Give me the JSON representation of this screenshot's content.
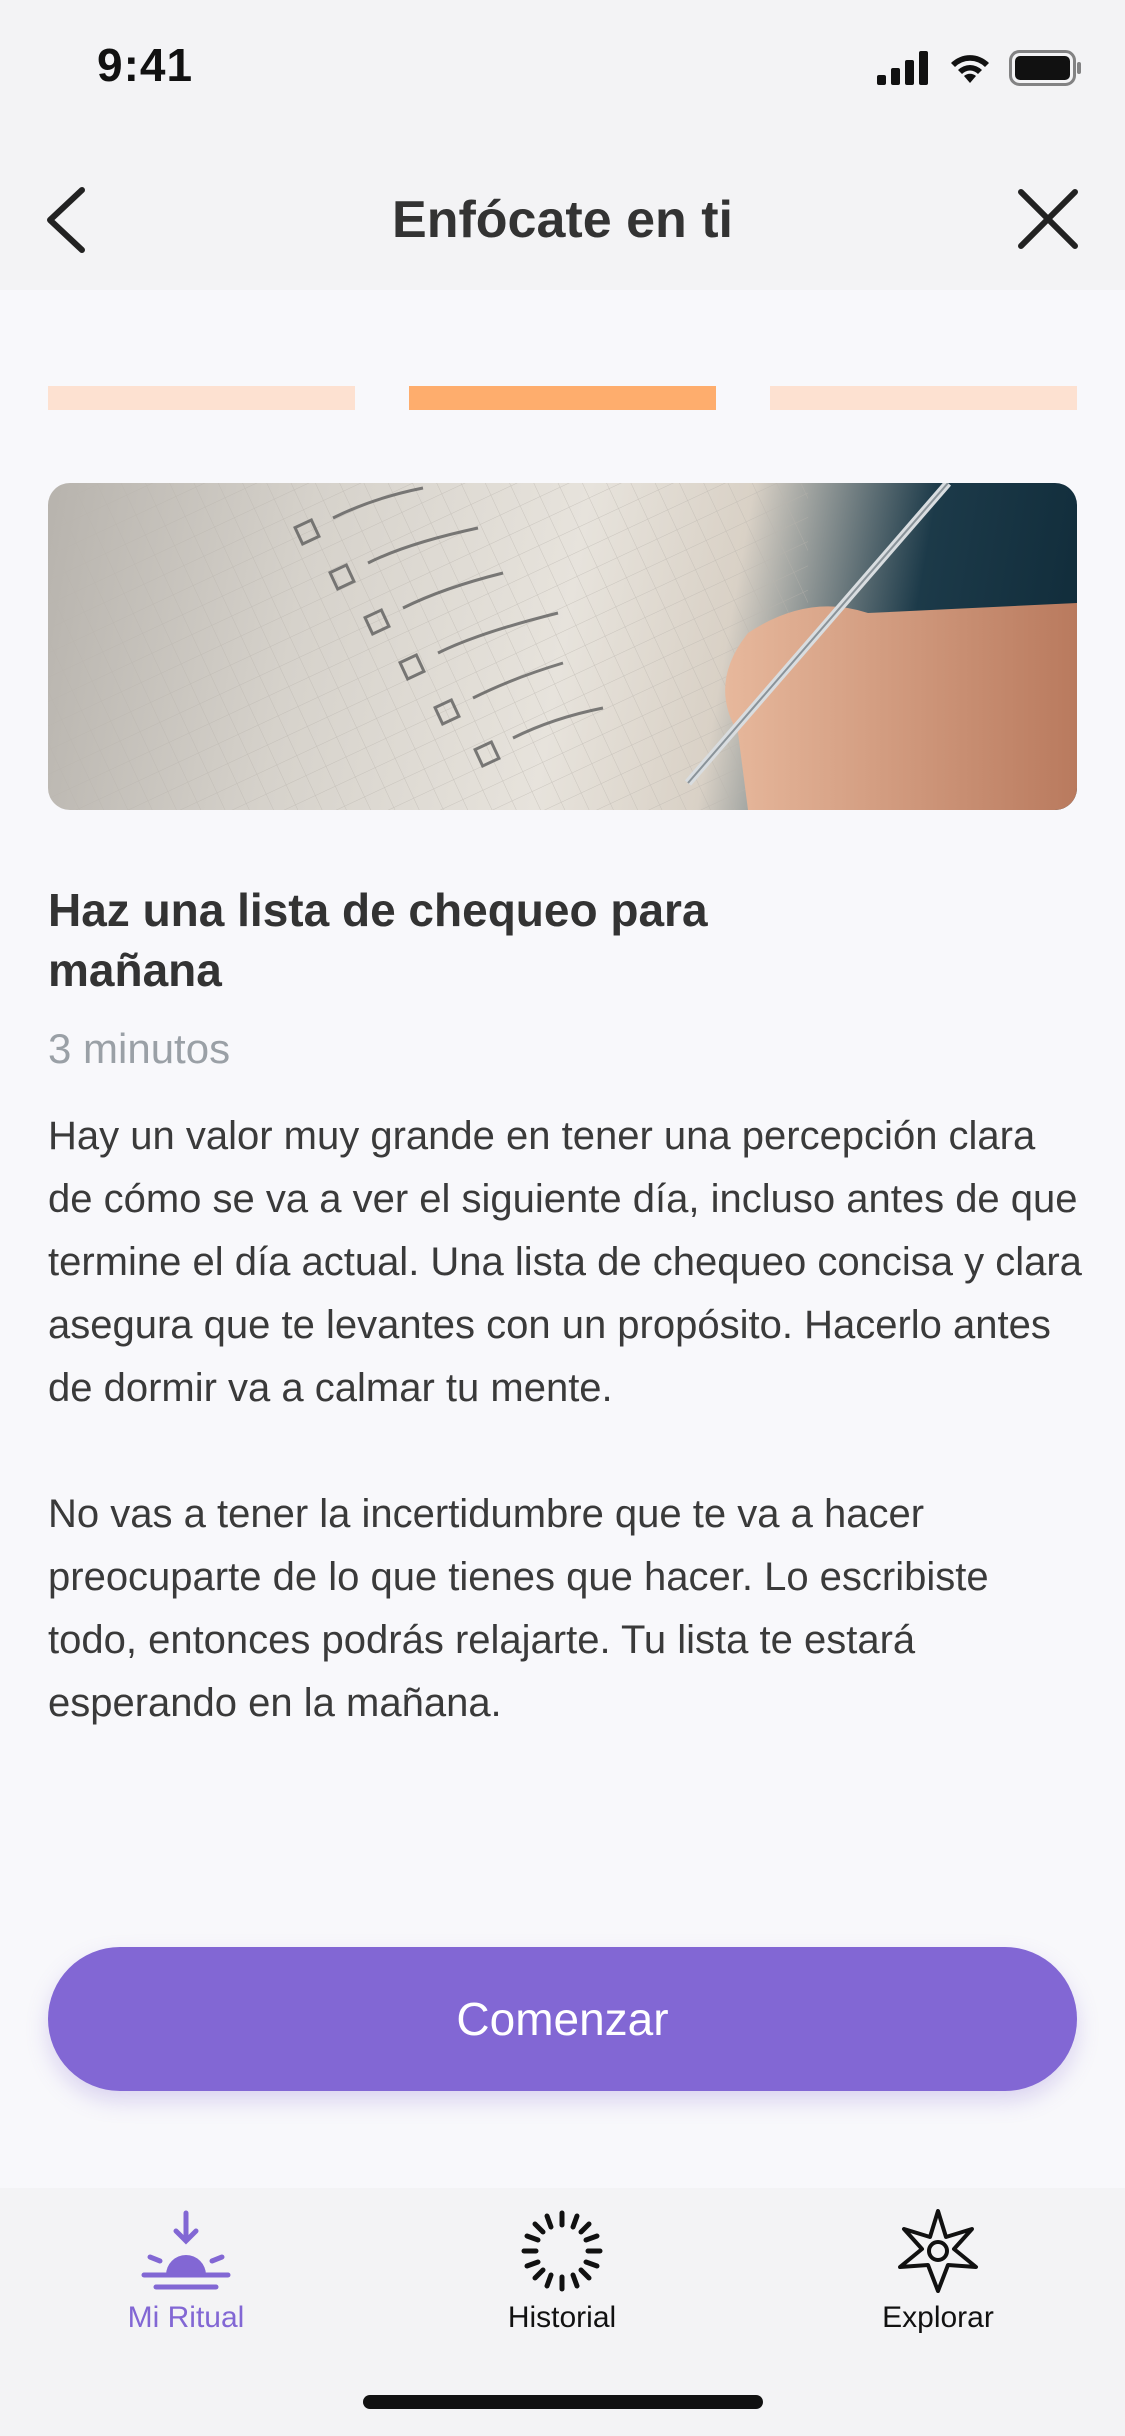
{
  "status": {
    "time": "9:41"
  },
  "nav": {
    "title": "Enfócate en ti"
  },
  "progress": {
    "segments": 3,
    "active_index": 1
  },
  "content": {
    "title": "Haz una lista de chequeo para mañana",
    "duration": "3 minutos",
    "paragraphs": [
      "Hay un valor muy grande en tener una percepción clara de cómo se va a ver el siguiente día, incluso antes de que termine el día actual. Una lista de chequeo concisa y clara asegura que te levantes con un propósito. Hacerlo antes de dormir va a calmar tu mente.",
      "No vas a tener la incertidumbre que te va a hacer preocuparte de lo que tienes que hacer. Lo escribiste todo, entonces podrás relajarte. Tu lista te estará esperando en la mañana."
    ]
  },
  "cta": {
    "label": "Comenzar"
  },
  "tabs": [
    {
      "label": "Mi Ritual",
      "icon": "sunrise-icon",
      "active": true
    },
    {
      "label": "Historial",
      "icon": "history-ring-icon",
      "active": false
    },
    {
      "label": "Explorar",
      "icon": "compass-icon",
      "active": false
    }
  ],
  "colors": {
    "accent": "#8267d4",
    "progress_active": "#fead6d",
    "progress_inactive": "#fde1d1"
  }
}
